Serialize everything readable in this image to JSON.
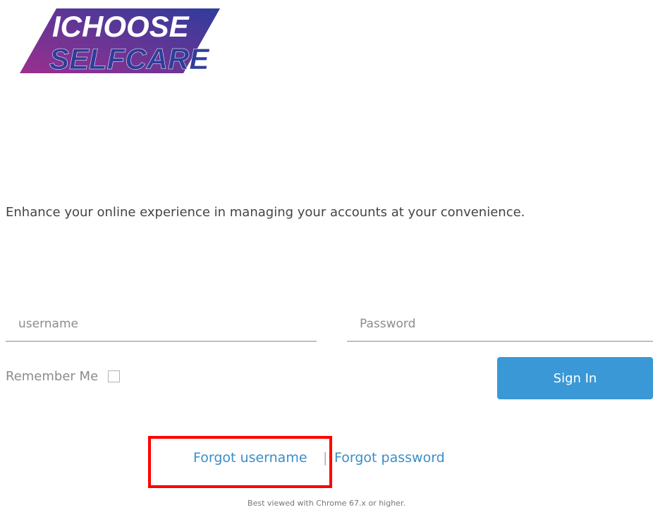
{
  "logo": {
    "line1": "ICHOOSE",
    "line2": "SELFCARE",
    "colors": {
      "gradient_start": "#8a2a8c",
      "gradient_end": "#2e3d9a",
      "text": "#ffffff",
      "text_secondary": "#2e3d9a"
    }
  },
  "tagline": "Enhance your online experience in managing your accounts at your convenience.",
  "login": {
    "username_placeholder": "username",
    "password_placeholder": "Password",
    "remember_label": "Remember Me",
    "remember_checked": false,
    "signin_label": "Sign In"
  },
  "links": {
    "forgot_username": "Forgot username",
    "separator": "|",
    "forgot_password": "Forgot password"
  },
  "footer_note": "Best viewed with Chrome 67.x or higher.",
  "colors": {
    "accent": "#3a98d6",
    "link": "#3a8ec6",
    "highlight": "#ff0000"
  }
}
